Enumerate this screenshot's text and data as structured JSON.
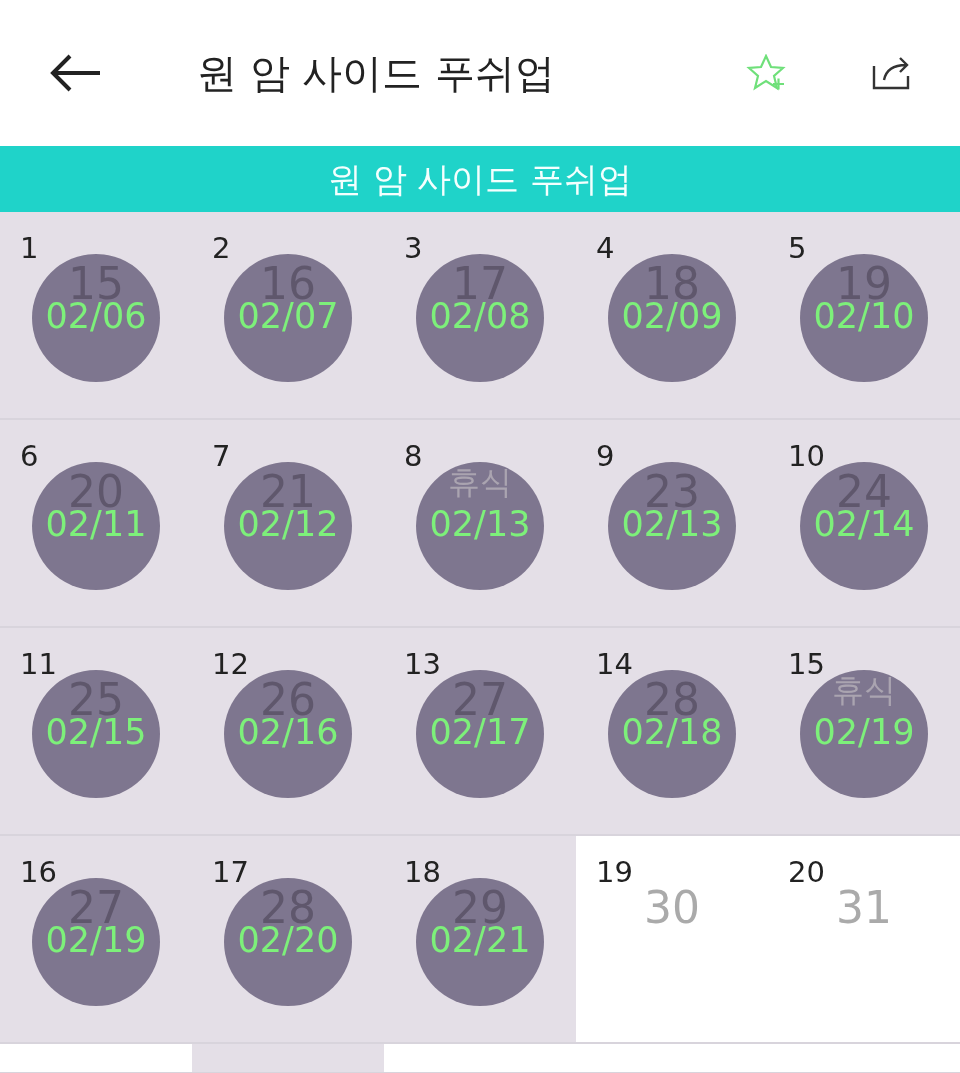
{
  "header": {
    "title": "원 암 사이드 푸쉬업"
  },
  "banner": {
    "title": "원 암 사이드 푸쉬업"
  },
  "calendar": [
    {
      "day": "1",
      "sub": "15",
      "rest": false,
      "done": true,
      "date": "02/06"
    },
    {
      "day": "2",
      "sub": "16",
      "rest": false,
      "done": true,
      "date": "02/07"
    },
    {
      "day": "3",
      "sub": "17",
      "rest": false,
      "done": true,
      "date": "02/08"
    },
    {
      "day": "4",
      "sub": "18",
      "rest": false,
      "done": true,
      "date": "02/09"
    },
    {
      "day": "5",
      "sub": "19",
      "rest": false,
      "done": true,
      "date": "02/10"
    },
    {
      "day": "6",
      "sub": "20",
      "rest": false,
      "done": true,
      "date": "02/11"
    },
    {
      "day": "7",
      "sub": "21",
      "rest": false,
      "done": true,
      "date": "02/12"
    },
    {
      "day": "8",
      "sub": "휴식",
      "rest": true,
      "done": true,
      "date": "02/13"
    },
    {
      "day": "9",
      "sub": "23",
      "rest": false,
      "done": true,
      "date": "02/13"
    },
    {
      "day": "10",
      "sub": "24",
      "rest": false,
      "done": true,
      "date": "02/14"
    },
    {
      "day": "11",
      "sub": "25",
      "rest": false,
      "done": true,
      "date": "02/15"
    },
    {
      "day": "12",
      "sub": "26",
      "rest": false,
      "done": true,
      "date": "02/16"
    },
    {
      "day": "13",
      "sub": "27",
      "rest": false,
      "done": true,
      "date": "02/17"
    },
    {
      "day": "14",
      "sub": "28",
      "rest": false,
      "done": true,
      "date": "02/18"
    },
    {
      "day": "15",
      "sub": "휴식",
      "rest": true,
      "done": true,
      "date": "02/19"
    },
    {
      "day": "16",
      "sub": "27",
      "rest": false,
      "done": true,
      "date": "02/19"
    },
    {
      "day": "17",
      "sub": "28",
      "rest": false,
      "done": true,
      "date": "02/20"
    },
    {
      "day": "18",
      "sub": "29",
      "rest": false,
      "done": true,
      "date": "02/21"
    },
    {
      "day": "19",
      "sub": "30",
      "done": false
    },
    {
      "day": "20",
      "sub": "31",
      "done": false
    }
  ],
  "calendar_cut_row": [
    {
      "done": false
    },
    {
      "done": true
    },
    {
      "done": false
    },
    {
      "done": false
    },
    {
      "done": false
    }
  ]
}
